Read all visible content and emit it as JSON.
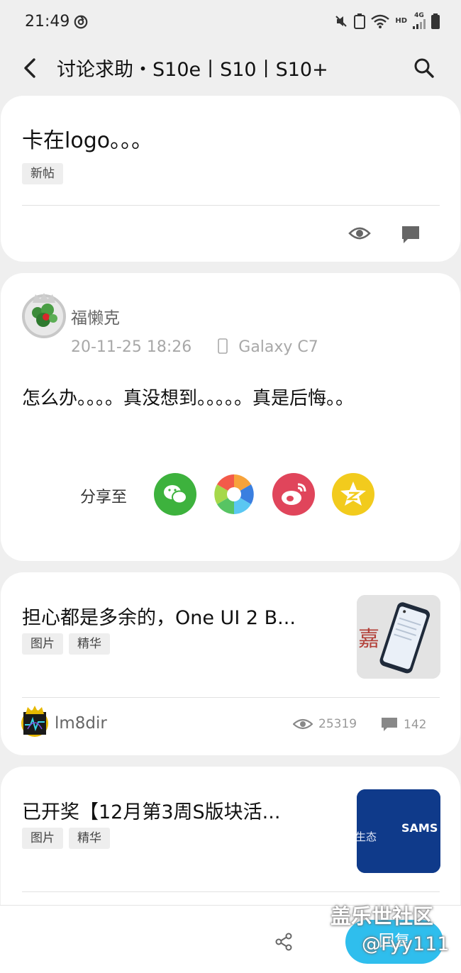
{
  "status_bar": {
    "time": "21:49",
    "network_label": "HD",
    "network_type": "4G"
  },
  "app_bar": {
    "title": "讨论求助・S10e丨S10丨S10+"
  },
  "post": {
    "title": "卡在logo。。。",
    "tag": "新帖"
  },
  "reply": {
    "author": "福懒克",
    "datetime": "20-11-25 18:26",
    "device": "Galaxy C7",
    "device_icon": "phone-icon",
    "content": "怎么办。。。。真没想到。。。。。真是后悔。。",
    "share_label": "分享至",
    "share_targets": [
      {
        "name": "wechat",
        "color": "#3db23d"
      },
      {
        "name": "moments",
        "color": "#ffffff"
      },
      {
        "name": "weibo",
        "color": "#e0455b"
      },
      {
        "name": "qzone",
        "color": "#f2cb1d"
      }
    ]
  },
  "feed": [
    {
      "title": "担心都是多余的，One UI 2 B...",
      "tags": [
        "图片",
        "精华"
      ],
      "username": "lm8dir",
      "views": "25319",
      "comments": "142"
    },
    {
      "title": "已开奖【12月第3周S版块活...",
      "tags": [
        "图片",
        "精华"
      ],
      "thumb_text": "SAMS",
      "thumb_side_text": "生态"
    }
  ],
  "bottom_bar": {
    "reply_label": "回复"
  },
  "watermark": {
    "line1": "盖乐世社区",
    "line2": "@Fyy111"
  },
  "colors": {
    "accent": "#2fbeed",
    "page_bg": "#efefef",
    "card_bg": "#ffffff"
  }
}
